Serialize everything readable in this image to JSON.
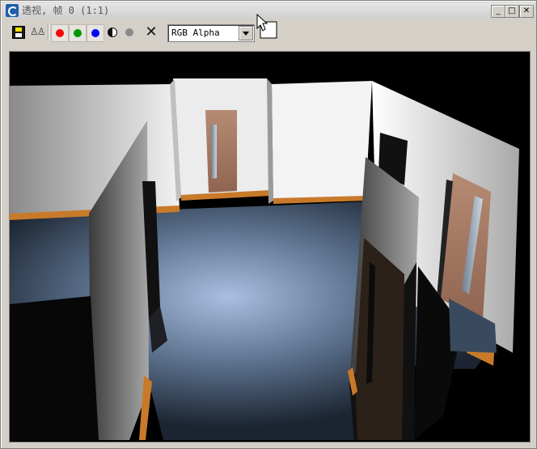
{
  "window": {
    "title": "透视, 帧 0 (1:1)"
  },
  "titlebar_buttons": {
    "minimize": "_",
    "maximize": "□",
    "close": "✕"
  },
  "toolbar": {
    "channel_select": "RGB Alpha"
  },
  "icons": [
    "save-icon",
    "clone-icon",
    "red-channel-icon",
    "green-channel-icon",
    "blue-channel-icon",
    "monochrome-icon",
    "clear-icon",
    "close-x-icon",
    "dropdown-arrow-icon"
  ],
  "colors": {
    "red": "#ff0000",
    "green": "#009900",
    "blue": "#0000ff",
    "floor": "#6f86a6",
    "trim": "#c87a2a",
    "wood": "#a47860"
  }
}
